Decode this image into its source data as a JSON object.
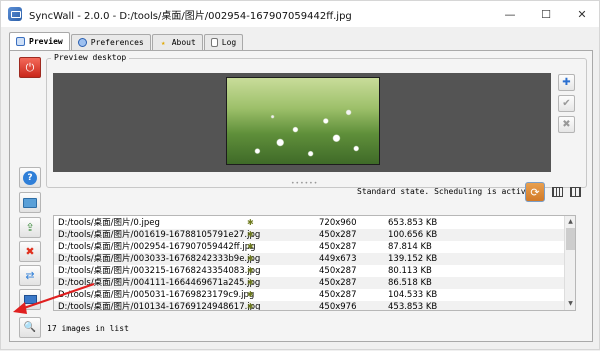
{
  "window": {
    "title": "SyncWall - 2.0.0 - D:/tools/桌面/图片/002954-167907059442ff.jpg",
    "minimize": "—",
    "maximize": "☐",
    "close": "✕"
  },
  "tabs": [
    {
      "label": "Preview",
      "icon": "monitor-icon"
    },
    {
      "label": "Preferences",
      "icon": "gear-icon"
    },
    {
      "label": "About",
      "icon": "star-icon"
    },
    {
      "label": "Log",
      "icon": "document-icon"
    }
  ],
  "preview": {
    "label": "Preview desktop",
    "image_alt": "daisies-wallpaper"
  },
  "status": {
    "text": "Standard state. Scheduling is activated"
  },
  "files": [
    {
      "path": "D:/tools/桌面/图片/0.jpeg",
      "dims": "720x960",
      "size": "653.853 KB"
    },
    {
      "path": "D:/tools/桌面/图片/001619-16788105791e27.jpg",
      "dims": "450x287",
      "size": "100.656 KB"
    },
    {
      "path": "D:/tools/桌面/图片/002954-167907059442ff.jpg",
      "dims": "450x287",
      "size": "87.814 KB"
    },
    {
      "path": "D:/tools/桌面/图片/003033-16768242333b9e.jpg",
      "dims": "449x673",
      "size": "139.152 KB"
    },
    {
      "path": "D:/tools/桌面/图片/003215-16768243354083.jpg",
      "dims": "450x287",
      "size": "80.113 KB"
    },
    {
      "path": "D:/tools/桌面/图片/004111-1664469671a245.jpg",
      "dims": "450x287",
      "size": "86.518 KB"
    },
    {
      "path": "D:/tools/桌面/图片/005031-16769823179c9.jpg",
      "dims": "450x287",
      "size": "104.533 KB"
    },
    {
      "path": "D:/tools/桌面/图片/010134-16769124948617.jpg",
      "dims": "450x976",
      "size": "453.853 KB"
    }
  ],
  "footer": {
    "count_text": "17 images in list"
  },
  "colors": {
    "accent": "#2c5fa8",
    "power_button": "#d9342b",
    "delete": "#e0301e",
    "annotation_arrow": "#e02020"
  }
}
